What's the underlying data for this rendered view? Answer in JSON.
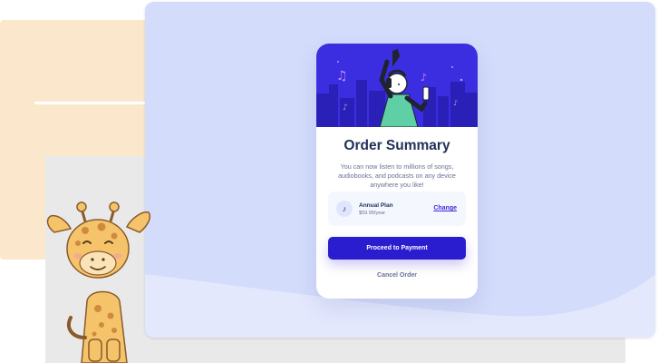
{
  "card": {
    "title": "Order Summary",
    "description": "You can now listen to millions of songs, audiobooks, and podcasts on any device anywhere you like!"
  },
  "plan": {
    "icon": "music-note-icon",
    "name": "Annual Plan",
    "price": "$59.99/year",
    "change_label": "Change"
  },
  "actions": {
    "proceed_label": "Proceed to Payment",
    "cancel_label": "Cancel Order"
  },
  "colors": {
    "stage_background": "#d3dcfb",
    "primary_button": "#2a1ccf",
    "title_text": "#1f2f56",
    "hero_background": "#3b2ee0"
  }
}
